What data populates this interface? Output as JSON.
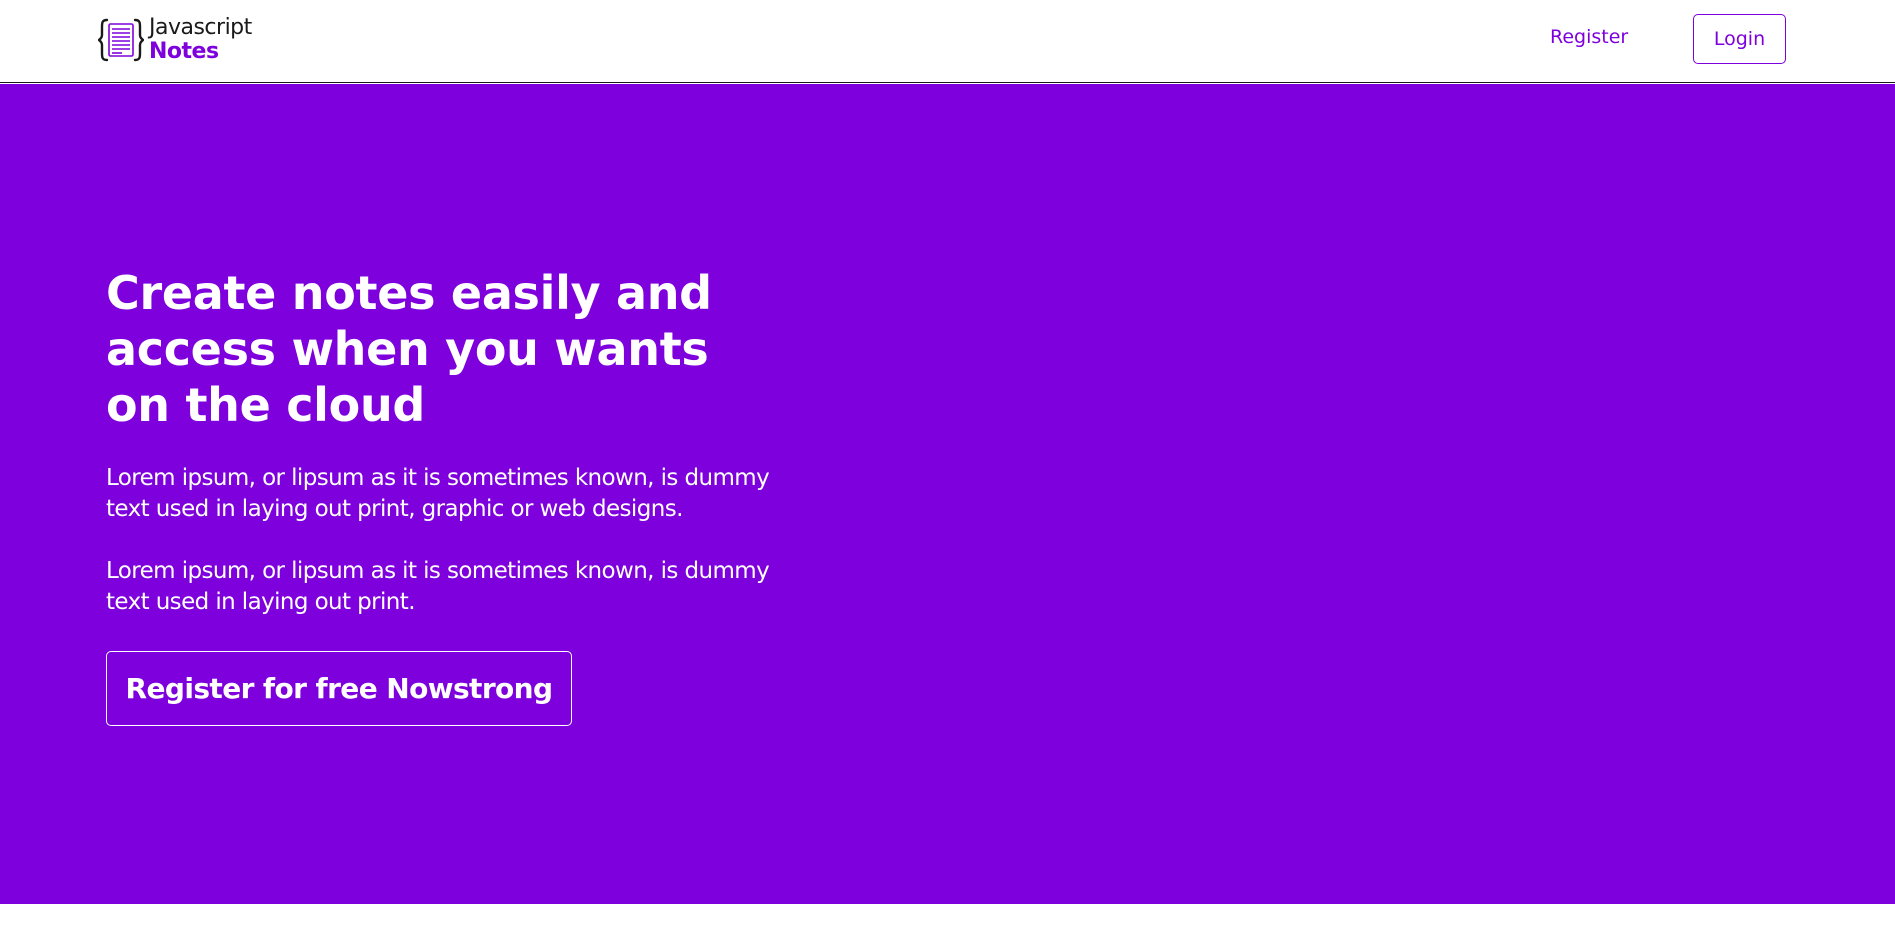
{
  "navbar": {
    "logo": {
      "line1": "Javascript",
      "line2": "Notes",
      "icon": "note-braces-icon"
    },
    "register_label": "Register",
    "login_label": "Login"
  },
  "hero": {
    "title": "Create notes easily and access when you wants on the cloud",
    "paragraph1": "Lorem ipsum, or lipsum as it is sometimes known, is dummy text used in laying out print, graphic or web designs.",
    "paragraph2": "Lorem ipsum, or lipsum as it is sometimes known, is dummy text used in laying out print.",
    "cta_label": "Register for free Nowstrong"
  },
  "colors": {
    "brand": "#7e00dc",
    "text_dark": "#1a1a1a",
    "white": "#ffffff"
  }
}
